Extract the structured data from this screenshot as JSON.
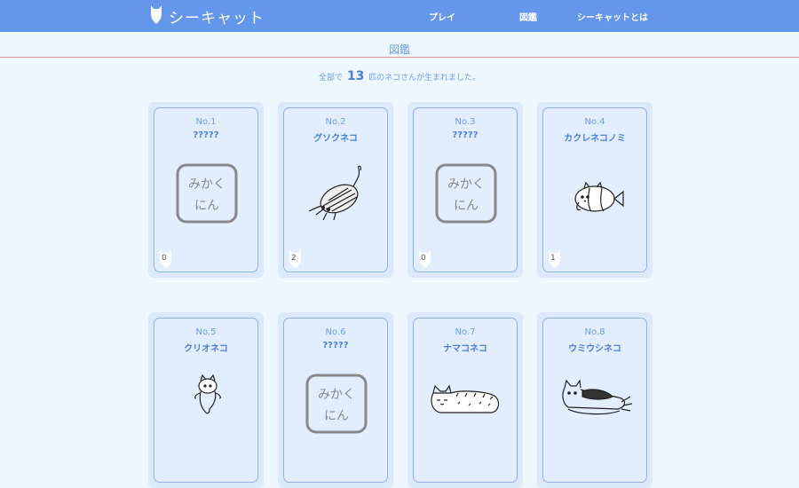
{
  "header": {
    "title": "シーキャット",
    "nav": [
      "プレイ",
      "図鑑",
      "シーキャットとは"
    ],
    "color": "#6496ec"
  },
  "page": {
    "title": "図鑑",
    "count_prefix": "全部で",
    "count": "13",
    "count_suffix": "匹のネコさんが生まれました。"
  },
  "cards": [
    {
      "no": "No.1",
      "name": "?????",
      "count": "0",
      "art": "unknown-stamp"
    },
    {
      "no": "No.2",
      "name": "グソクネコ",
      "count": "2",
      "art": "isopod-cat"
    },
    {
      "no": "No.3",
      "name": "?????",
      "count": "0",
      "art": "unknown-stamp"
    },
    {
      "no": "No.4",
      "name": "カクレネコノミ",
      "count": "1",
      "art": "clownfish-cat"
    },
    {
      "no": "No.5",
      "name": "クリオネコ",
      "count": "",
      "art": "clione-cat"
    },
    {
      "no": "No.6",
      "name": "?????",
      "count": "",
      "art": "unknown-stamp"
    },
    {
      "no": "No.7",
      "name": "ナマコネコ",
      "count": "",
      "art": "sea-cucumber-cat"
    },
    {
      "no": "No.8",
      "name": "ウミウシネコ",
      "count": "",
      "art": "sea-slug-cat"
    }
  ],
  "unknown_stamp_text": [
    "みかく",
    "にん"
  ]
}
